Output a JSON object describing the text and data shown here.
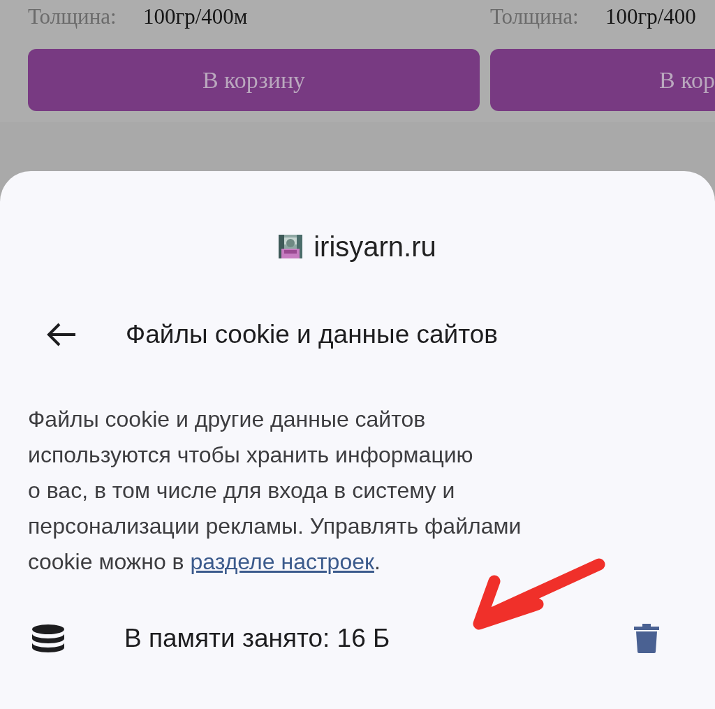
{
  "products": [
    {
      "thickness_label": "Толщина:",
      "thickness_value": "100гр/400м",
      "cart_button": "В корзину"
    },
    {
      "thickness_label": "Толщина:",
      "thickness_value": "100гр/400",
      "cart_button": "В кор"
    }
  ],
  "sheet": {
    "site": "irisyarn.ru",
    "title": "Файлы cookie и данные сайтов",
    "description": {
      "lines": [
        "Файлы cookie и другие данные сайтов",
        "используются чтобы хранить информацию",
        "о вас, в том числе для входа в систему и",
        "персонализации рекламы. Управлять файлами",
        "cookie можно в "
      ],
      "link": "разделе настроек",
      "after": "."
    },
    "storage": "В памяти занято: 16 Б"
  }
}
